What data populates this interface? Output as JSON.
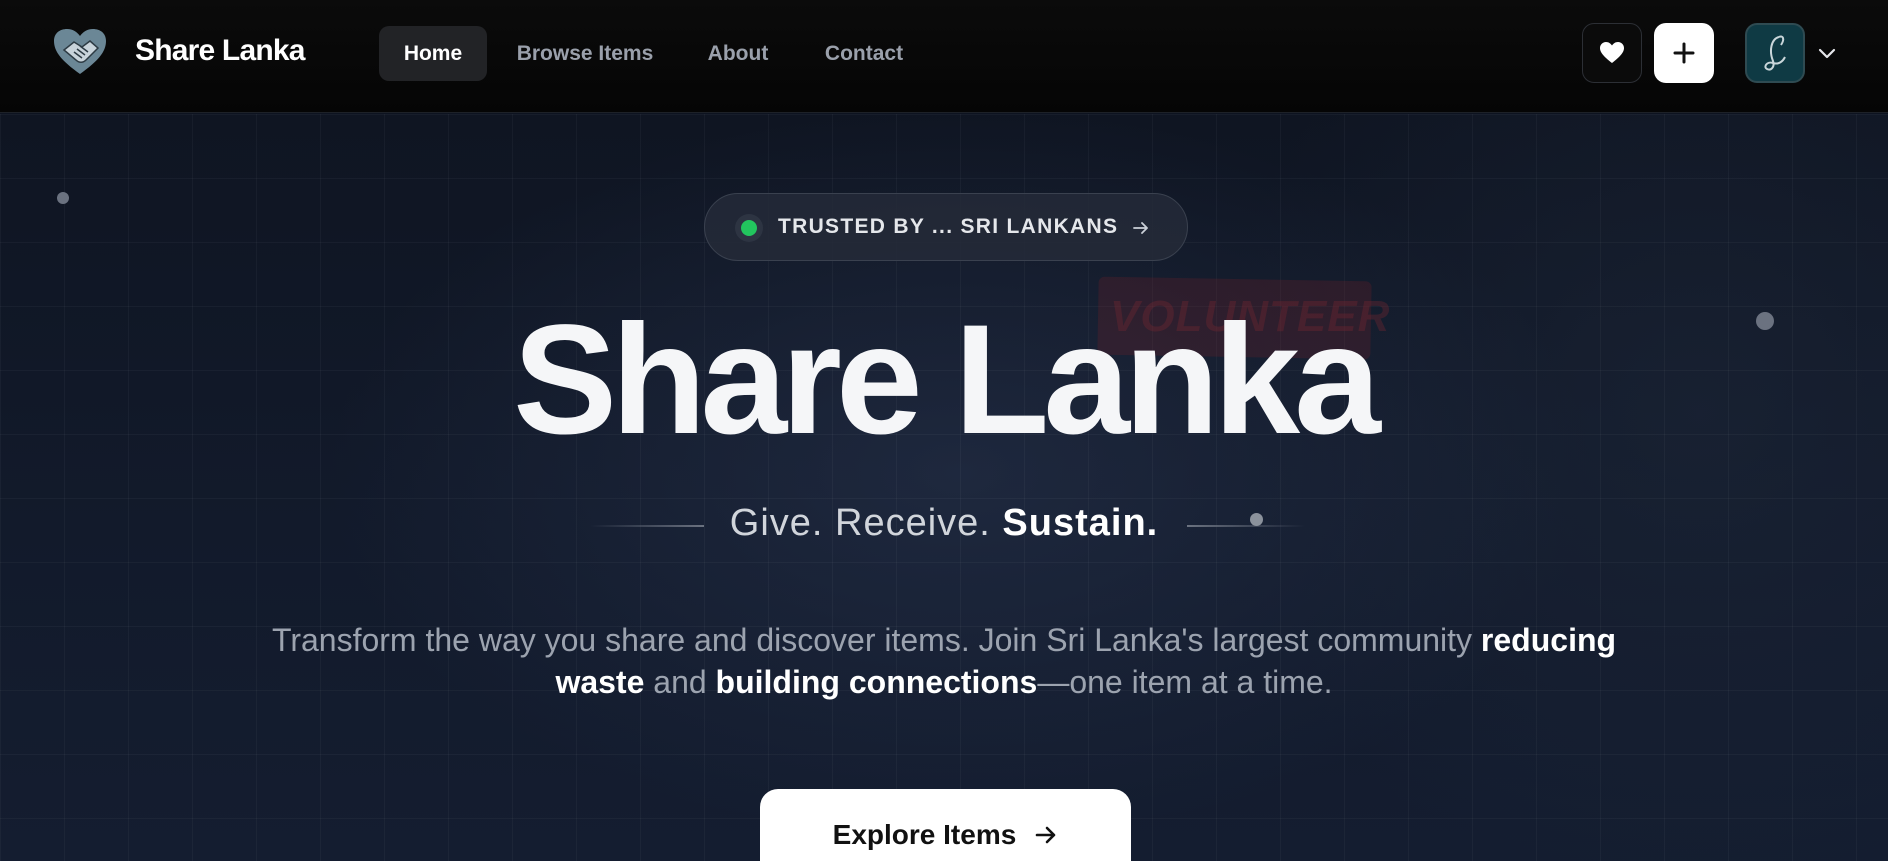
{
  "header": {
    "brand": "Share Lanka",
    "logo_icon": "handshake-heart-icon",
    "nav": [
      {
        "label": "Home",
        "active": true
      },
      {
        "label": "Browse Items",
        "active": false
      },
      {
        "label": "About",
        "active": false
      },
      {
        "label": "Contact",
        "active": false
      }
    ],
    "actions": {
      "favorites_icon": "heart-icon",
      "add_icon": "plus-icon",
      "avatar_icon": "signature-avatar-icon",
      "menu_icon": "chevron-down-icon"
    }
  },
  "hero": {
    "badge": {
      "text": "TRUSTED BY ... SRI LANKANS",
      "status_color": "#22c55e",
      "arrow_icon": "arrow-right-icon"
    },
    "background_sign_text": "VOLUNTEER",
    "title": "Share Lanka",
    "tagline": {
      "part1": "Give. Receive. ",
      "emphasis": "Sustain."
    },
    "description": {
      "p1": "Transform the way you share and discover items. Join Sri Lanka's largest community ",
      "b1": "reducing waste",
      "p2": " and ",
      "b2": "building connections",
      "p3": "—one item at a time."
    },
    "cta": {
      "label": "Explore Items",
      "icon": "arrow-right-icon"
    }
  },
  "colors": {
    "background": "#0d1320",
    "navbar": "#050505",
    "accent_green": "#22c55e",
    "cta_background": "#ffffff"
  }
}
